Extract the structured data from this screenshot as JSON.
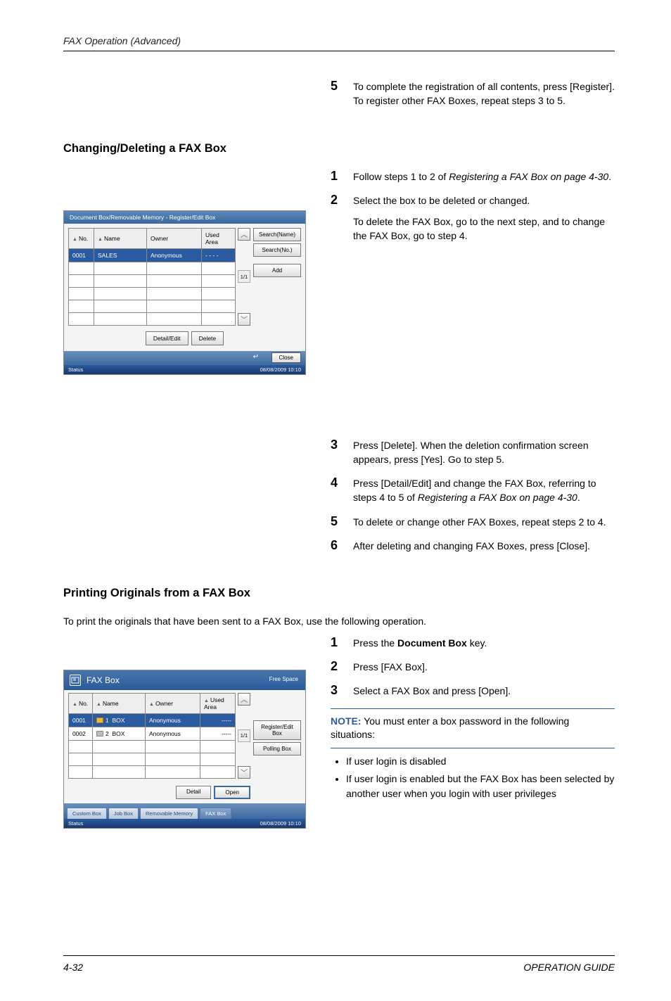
{
  "header": {
    "section": "FAX Operation (Advanced)"
  },
  "step5_top": {
    "num": "5",
    "text_a": "To complete the registration of all contents, press [Register]. To register other FAX Boxes, repeat steps 3 to 5."
  },
  "heading_change": "Changing/Deleting a FAX Box",
  "change_steps_a": [
    {
      "num": "1",
      "text": "Follow steps 1 to 2 of ",
      "ital": "Registering a FAX Box on page 4-30",
      "after": "."
    },
    {
      "num": "2",
      "text": "Select the box to be deleted or changed."
    }
  ],
  "change_extra": "To delete the FAX Box, go to the next step, and to change the FAX Box, go to step 4.",
  "change_steps_b": [
    {
      "num": "3",
      "text": "Press [Delete]. When the deletion confirmation screen appears, press [Yes]. Go to step 5."
    },
    {
      "num": "4",
      "text": "Press [Detail/Edit] and change the FAX Box, referring to steps 4 to 5 of ",
      "ital": "Registering a FAX Box on page 4-30",
      "after": "."
    },
    {
      "num": "5",
      "text": "To delete or change other FAX Boxes, repeat steps 2 to 4."
    },
    {
      "num": "6",
      "text": "After deleting and changing FAX Boxes, press [Close]."
    }
  ],
  "heading_print": "Printing Originals from a FAX Box",
  "print_intro": "To print the originals that have been sent to a FAX Box, use the following operation.",
  "print_steps": [
    {
      "num": "1",
      "pre": "Press the ",
      "bold": "Document Box",
      "post": " key."
    },
    {
      "num": "2",
      "text": "Press [FAX Box]."
    },
    {
      "num": "3",
      "text": "Select a FAX Box and press [Open]."
    }
  ],
  "note": {
    "label": "NOTE:",
    "text": " You must enter a box password in the following situations:"
  },
  "note_bullets": [
    "If user login is disabled",
    "If user login is enabled but the FAX Box has been selected by another user when you login with user privileges"
  ],
  "panel1": {
    "title": "Document Box/Removable Memory - Register/Edit Box",
    "cols": {
      "no": "No.",
      "name": "Name",
      "owner": "Owner",
      "used": "Used Area"
    },
    "row": {
      "no": "0001",
      "name": "SALES",
      "owner": "Anonymous",
      "used": "- - - -"
    },
    "page": "1/1",
    "btn_search_name": "Search(Name)",
    "btn_search_no": "Search(No.)",
    "btn_add": "Add",
    "btn_detail": "Detail/Edit",
    "btn_delete": "Delete",
    "btn_close": "Close",
    "status": "Status",
    "datetime": "08/08/2009    10:10"
  },
  "panel2": {
    "title": "FAX Box",
    "freespace": "Free Space",
    "cols": {
      "no": "No.",
      "name": "Name",
      "owner": "Owner",
      "used": "Used Area"
    },
    "rows": [
      {
        "no": "0001",
        "idx": "1",
        "name": "BOX",
        "owner": "Anonymous",
        "used": "-----"
      },
      {
        "no": "0002",
        "idx": "2",
        "name": "BOX",
        "owner": "Anonymous",
        "used": "-----"
      }
    ],
    "page": "1/1",
    "btn_register": "Register/Edit Box",
    "btn_polling": "Polling Box",
    "btn_detail": "Detail",
    "btn_open": "Open",
    "tabs": {
      "custom": "Custom Box",
      "job": "Job Box",
      "removable": "Removable Memory",
      "fax": "FAX Box"
    },
    "status": "Status",
    "datetime": "08/08/2009    10:10"
  },
  "footer": {
    "left": "4-32",
    "right": "OPERATION GUIDE"
  }
}
